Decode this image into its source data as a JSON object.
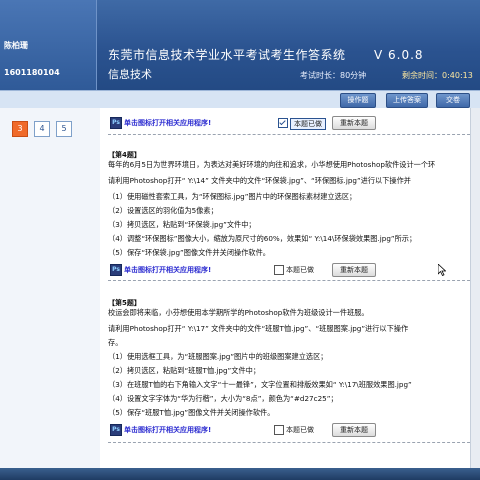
{
  "header": {
    "student_name": "陈柏珊",
    "student_id": "1601180104",
    "system_title": "东莞市信息技术学业水平考试考生作答系统",
    "subject": "信息技术",
    "version": "V 6.0.8",
    "exam_time": "考试时长：80分钟",
    "remaining_time": "剩余时间：0:40:13"
  },
  "toolbar": {
    "operate_label": "操作题",
    "submit_label": "上传答案",
    "hand_in_label": "交卷"
  },
  "question_nav": [
    "3",
    "4",
    "5"
  ],
  "question_nav_active": "3",
  "q_top": {
    "open_link": "单击图标打开相关应用程序!",
    "done_label": "本题已做",
    "done_checked": true,
    "redo_label": "重新本题"
  },
  "q4": {
    "number": "【第4题】",
    "lines": [
      "每年的6月5日为世界环境日，为表达对美好环境的向往和追求，小华想使用Photoshop软件设计一个环",
      "请利用Photoshop打开“ Y:\\14” 文件夹中的文件“环保袋.jpg”、“环保图标.jpg”进行以下操作并",
      "（1）使用磁性套索工具，为“环保图标.jpg”图片中的环保图标素材建立选区；",
      "（2）设置选区的羽化值为5像素；",
      "（3）拷贝选区，粘贴到“环保袋.jpg”文件中；",
      "（4）调整“环保图标”图像大小，缩放为原尺寸的60%，效果如“ Y:\\14\\环保袋效果图.jpg”所示；",
      "（5）保存“环保袋.jpg”图像文件并关闭操作软件。"
    ],
    "open_link": "单击图标打开相关应用程序!",
    "done_label": "本题已做",
    "done_checked": false,
    "redo_label": "重新本题"
  },
  "q5": {
    "number": "【第5题】",
    "lines": [
      "校运会即将来临，小芬想使用本学期所学的Photoshop软件为班级设计一件班服。",
      "请利用Photoshop打开“ Y:\\17” 文件夹中的文件“班服T恤.jpg”、“班服图案.jpg”进行以下操作",
      "存。",
      "（1）使用选框工具，为“班服图案.jpg”图片中的班级图案建立选区；",
      "（2）拷贝选区，粘贴到“班服T恤.jpg”文件中；",
      "（3）在班服T恤的右下角输入文字“十一最锋”，文字位置和排版效果如“ Y:\\17\\班服效果图.jpg”",
      "（4）设置文字字体为“华为行楷”，大小为“8点”，颜色为“#d27c25”；",
      "（5）保存“班服T恤.jpg”图像文件并关闭操作软件。"
    ],
    "open_link": "单击图标打开相关应用程序!",
    "done_label": "本题已做",
    "done_checked": false,
    "redo_label": "重新本题"
  },
  "colors": {
    "header_blue": "#2b5390",
    "active_question": "#f06a2a",
    "link_blue": "#2b2bd0"
  },
  "icons": [
    "photoshop-icon",
    "checkbox-icon",
    "mouse-cursor-icon"
  ]
}
